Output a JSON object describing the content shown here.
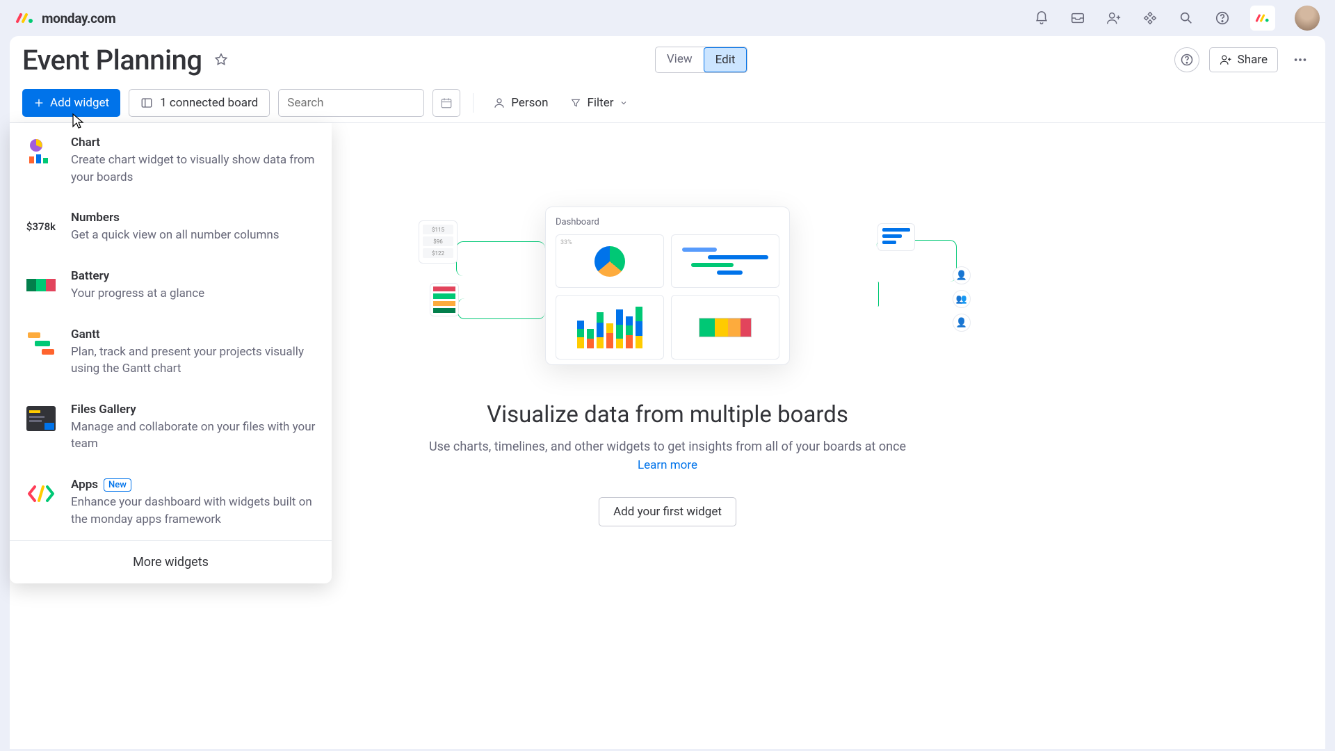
{
  "brand": "monday.com",
  "page_title": "Event Planning",
  "mode_tabs": {
    "view": "View",
    "edit": "Edit"
  },
  "share_label": "Share",
  "toolbar": {
    "add_widget": "Add widget",
    "connected": "1 connected board",
    "search_placeholder": "Search",
    "person": "Person",
    "filter": "Filter"
  },
  "dropdown": {
    "items": [
      {
        "title": "Chart",
        "desc": "Create chart widget to visually show data from your boards"
      },
      {
        "title": "Numbers",
        "desc": "Get a quick view on all number columns",
        "icon_text": "$378k"
      },
      {
        "title": "Battery",
        "desc": "Your progress at a glance"
      },
      {
        "title": "Gantt",
        "desc": "Plan, track and present your projects visually using the Gantt chart"
      },
      {
        "title": "Files Gallery",
        "desc": "Manage and collaborate on your files with your team"
      },
      {
        "title": "Apps",
        "desc": "Enhance your dashboard with widgets built on the monday apps framework",
        "badge": "New"
      }
    ],
    "more": "More widgets"
  },
  "empty": {
    "dash_label": "Dashboard",
    "title": "Visualize data from multiple boards",
    "subtitle": "Use charts, timelines, and other widgets to get insights from all of your boards at once",
    "learn": "Learn more",
    "cta": "Add your first widget"
  },
  "illus_nums": [
    "$115",
    "$96",
    "$122"
  ]
}
